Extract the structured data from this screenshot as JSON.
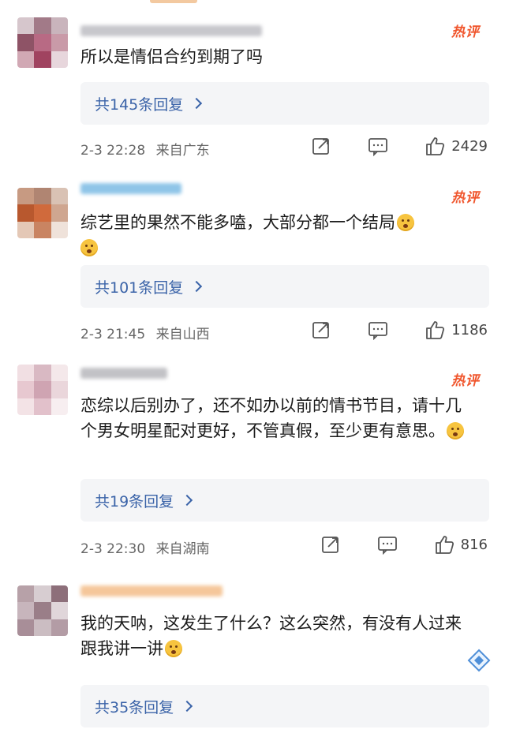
{
  "comments": [
    {
      "hot_label": "热评",
      "text": "所以是情侣合约到期了吗",
      "replies": "共145条回复",
      "time": "2-3 22:28",
      "location": "来自广东",
      "likes": "2429",
      "avatar_colors": [
        "#d6c6cc",
        "#a27a88",
        "#c9b4bc",
        "#8e5366",
        "#b86a84",
        "#c99aa8",
        "#d1a8b4",
        "#a04360",
        "#e7d6dc"
      ],
      "name_color": "#c7c7cc"
    },
    {
      "hot_label": "热评",
      "text": "综艺里的果然不能多嗑，大部分都一个结局",
      "text_has_trailing_emoji": true,
      "extra_emoji": true,
      "replies": "共101条回复",
      "time": "2-3 21:45",
      "location": "来自山西",
      "likes": "1186",
      "avatar_colors": [
        "#c79a82",
        "#b08572",
        "#d9c2b4",
        "#b8582e",
        "#d06a3c",
        "#cfa690",
        "#e4c8b6",
        "#c98462",
        "#efe2da"
      ],
      "name_color": "#8fc5e8"
    },
    {
      "hot_label": "热评",
      "text": "恋综以后别办了，还不如办以前的情书节目，请十几个男女明星配对更好，不管真假，至少更有意思。",
      "text_has_trailing_emoji": true,
      "replies": "共19条回复",
      "time": "2-3 22:30",
      "location": "来自湖南",
      "likes": "816",
      "avatar_colors": [
        "#f1dfe3",
        "#d9b9c3",
        "#f4e8ea",
        "#e7c8d0",
        "#cfa4b2",
        "#ead6db",
        "#f3e3e6",
        "#e2c1cb",
        "#f7eef0"
      ],
      "name_color": "#c2c2c6"
    },
    {
      "text": "我的天呐，这发生了什么？这么突然，有没有人过来跟我讲一讲",
      "text_has_trailing_emoji": true,
      "replies": "共35条回复",
      "avatar_colors": [
        "#b7a1a8",
        "#d7cdd1",
        "#8d6f7a",
        "#c7b5bc",
        "#9a7e88",
        "#e0d6da",
        "#a88e98",
        "#cbbdc2",
        "#b39ca5"
      ],
      "name_color": "#f5c79a"
    }
  ]
}
